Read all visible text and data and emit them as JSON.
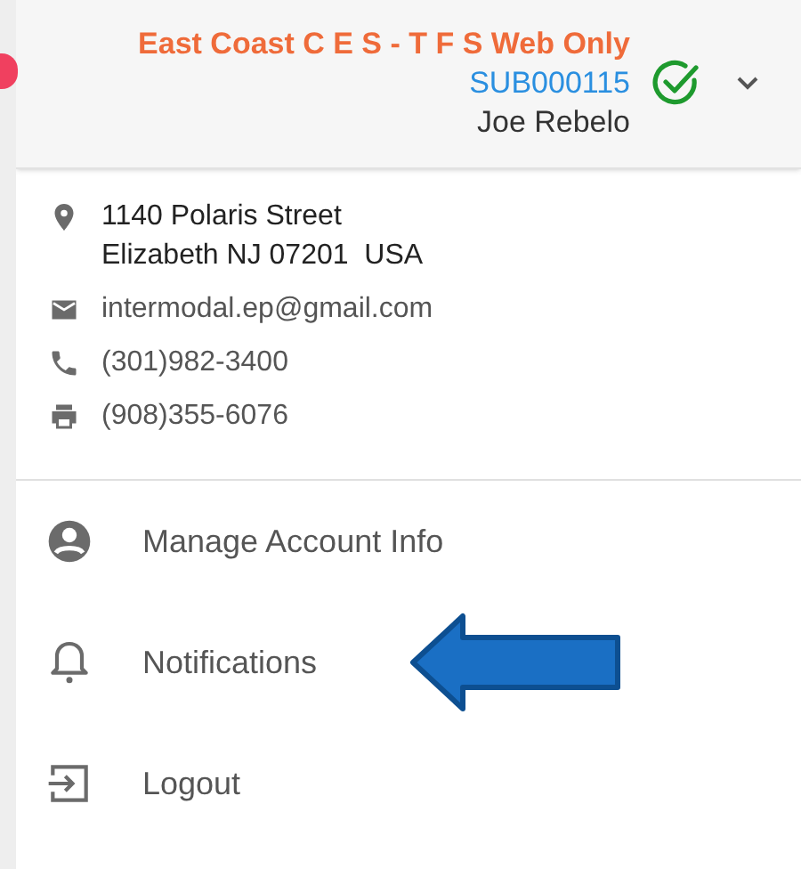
{
  "header": {
    "company": "East Coast C E S - T F S Web Only",
    "account_id": "SUB000115",
    "user": "Joe Rebelo",
    "verified": true
  },
  "contact": [
    {
      "kind": "address",
      "lines": [
        "1140 Polaris Street",
        "Elizabeth NJ 07201  USA"
      ]
    },
    {
      "kind": "email",
      "lines": [
        "intermodal.ep@gmail.com"
      ]
    },
    {
      "kind": "phone",
      "lines": [
        "(301)982-3400"
      ]
    },
    {
      "kind": "fax",
      "lines": [
        "(908)355-6076"
      ]
    }
  ],
  "menu": [
    {
      "kind": "account",
      "label": "Manage Account Info"
    },
    {
      "kind": "notifications",
      "label": "Notifications"
    },
    {
      "kind": "logout",
      "label": "Logout"
    }
  ]
}
